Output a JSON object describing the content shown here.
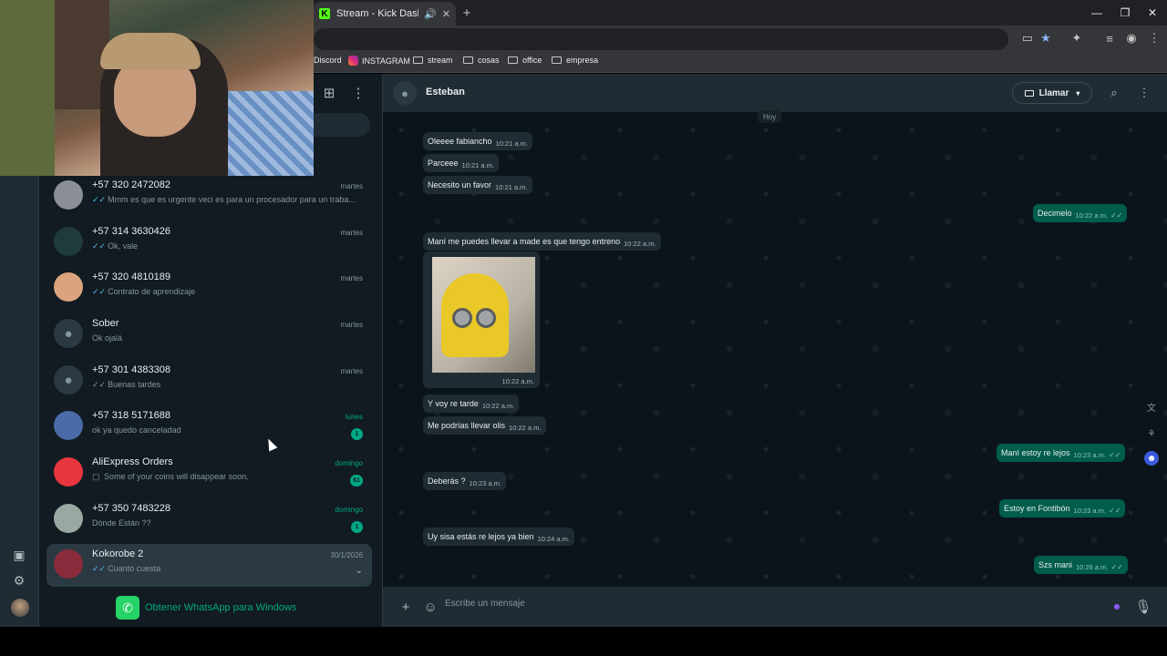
{
  "browser": {
    "tab_title": "Stream - Kick Dashboard",
    "tab_favicon_letter": "K",
    "bookmarks": [
      "Discord",
      "INSTAGRAM",
      "stream",
      "cosas",
      "office",
      "empresa"
    ]
  },
  "sidebar": {
    "chats": [
      {
        "name": "+57 320 2472082",
        "time": "martes",
        "preview": "Mmm es que es urgente veci es para un procesador para un traba...",
        "tick": "blue"
      },
      {
        "name": "+57 314 3630426",
        "time": "martes",
        "preview": "Ok, vale",
        "tick": "blue"
      },
      {
        "name": "+57 320 4810189",
        "time": "martes",
        "preview": "Contrato de aprendizaje",
        "tick": "blue"
      },
      {
        "name": "Sober",
        "time": "martes",
        "preview": "Ok ojalá",
        "tick": ""
      },
      {
        "name": "+57 301 4383308",
        "time": "martes",
        "preview": "Buenas tardes",
        "tick": "grey"
      },
      {
        "name": "+57 318 5171688",
        "time": "lunes",
        "preview": "ok ya quedo canceladad",
        "badge": "1"
      },
      {
        "name": "AliExpress Orders",
        "time": "domingo",
        "preview": "Some of your coins will disappear soon.",
        "badge": "61"
      },
      {
        "name": "+57 350 7483228",
        "time": "domingo",
        "preview": "Dónde Están ??",
        "badge": "1"
      },
      {
        "name": "Kokorobe 2",
        "time": "30/1/2026",
        "preview": "Cuanto cuesta",
        "tick": "blue"
      }
    ],
    "get_app": "Obtener WhatsApp para Windows"
  },
  "conversation": {
    "contact": "Esteban",
    "call_label": "Llamar",
    "day": "Hoy",
    "image_time": "10:22 a.m.",
    "messages": [
      {
        "text": "Oleeee fabiancho",
        "time": "10:21 a.m."
      },
      {
        "text": "Parceee",
        "time": "10:21 a.m."
      },
      {
        "text": "Necesito un favor",
        "time": "10:21 a.m."
      },
      {
        "text": "Decimelo",
        "time": "10:22 a.m."
      },
      {
        "text": "Maní me puedes llevar a made es que tengo entreno",
        "time": "10:22 a.m."
      },
      {
        "text": "Y voy re tarde",
        "time": "10:22 a.m."
      },
      {
        "text": "Me podrías llevar olis",
        "time": "10:22 a.m."
      },
      {
        "text": "Maní estoy re lejos",
        "time": "10:23 a.m."
      },
      {
        "text": "Deberás ?",
        "time": "10:23 a.m."
      },
      {
        "text": "Estoy en Fontibón",
        "time": "10:23 a.m."
      },
      {
        "text": "Uy sisa estás re lejos ya bien",
        "time": "10:24 a.m."
      },
      {
        "text": "Szs mani",
        "time": "10:26 a.m."
      }
    ],
    "composer_placeholder": "Escribe un mensaje"
  },
  "colors": {
    "accent": "#00a884",
    "outgoing": "#005c4b",
    "incoming": "#202c33",
    "background": "#0b141a"
  }
}
